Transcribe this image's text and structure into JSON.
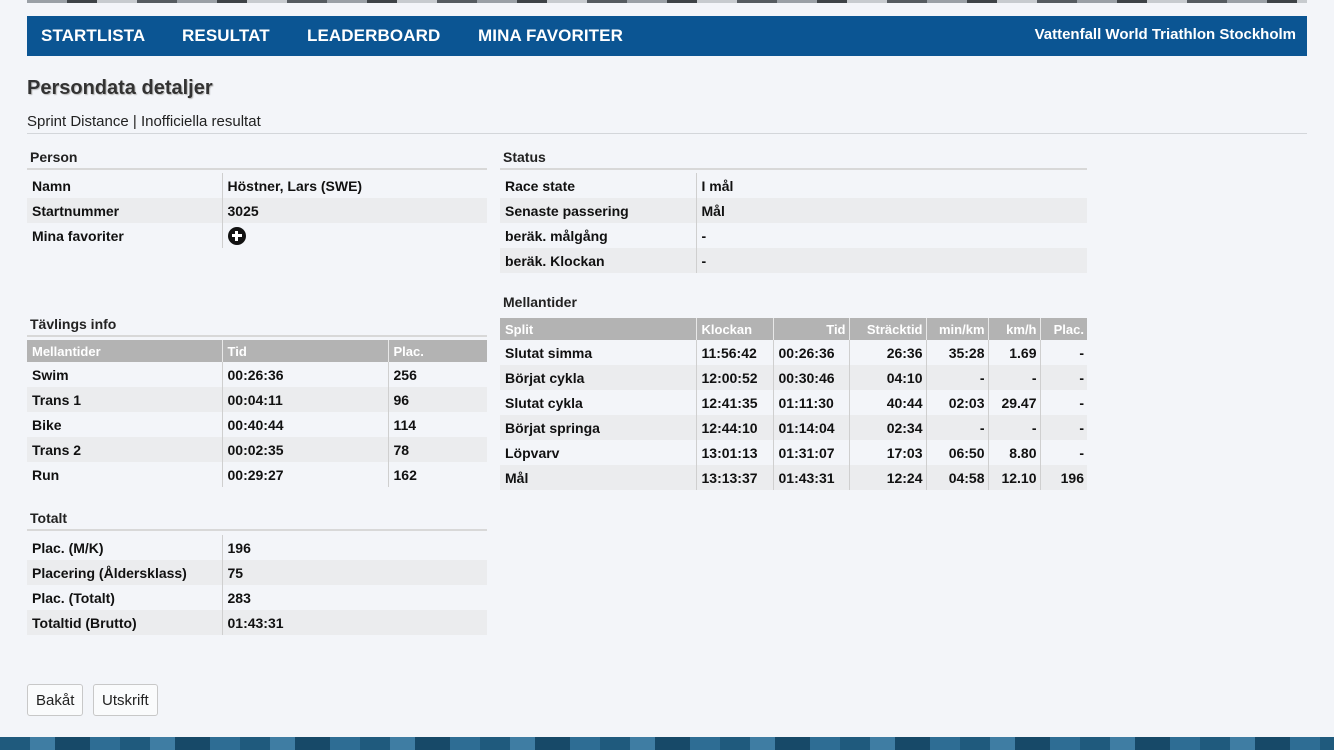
{
  "nav": {
    "items": [
      "STARTLISTA",
      "RESULTAT",
      "LEADERBOARD",
      "MINA FAVORITER"
    ],
    "site_title": "Vattenfall World Triathlon Stockholm",
    "color": "#0b5593"
  },
  "page": {
    "title": "Persondata detaljer",
    "subtitle": "Sprint Distance | Inofficiella resultat"
  },
  "person": {
    "heading": "Person",
    "rows": [
      {
        "label": "Namn",
        "value": "Höstner, Lars (SWE)"
      },
      {
        "label": "Startnummer",
        "value": "3025"
      },
      {
        "label": "Mina favoriter",
        "icon": "plus-circle-icon"
      }
    ]
  },
  "status": {
    "heading": "Status",
    "rows": [
      {
        "label": "Race state",
        "value": "I mål"
      },
      {
        "label": "Senaste passering",
        "value": "Mål"
      },
      {
        "label": "beräk. målgång",
        "value": "-"
      },
      {
        "label": "beräk. Klockan",
        "value": "-"
      }
    ]
  },
  "competition_info": {
    "heading": "Tävlings info",
    "columns": [
      "Mellantider",
      "Tid",
      "Plac."
    ],
    "rows": [
      [
        "Swim",
        "00:26:36",
        "256"
      ],
      [
        "Trans 1",
        "00:04:11",
        "96"
      ],
      [
        "Bike",
        "00:40:44",
        "114"
      ],
      [
        "Trans 2",
        "00:02:35",
        "78"
      ],
      [
        "Run",
        "00:29:27",
        "162"
      ]
    ]
  },
  "totals": {
    "heading": "Totalt",
    "rows": [
      {
        "label": "Plac. (M/K)",
        "value": "196"
      },
      {
        "label": "Placering (Åldersklass)",
        "value": "75"
      },
      {
        "label": "Plac. (Totalt)",
        "value": "283"
      },
      {
        "label": "Totaltid (Brutto)",
        "value": "01:43:31"
      }
    ]
  },
  "splits": {
    "heading": "Mellantider",
    "columns": [
      "Split",
      "Klockan",
      "Tid",
      "Sträcktid",
      "min/km",
      "km/h",
      "Plac."
    ],
    "rows": [
      [
        "Slutat simma",
        "11:56:42",
        "00:26:36",
        "26:36",
        "35:28",
        "1.69",
        "-"
      ],
      [
        "Börjat cykla",
        "12:00:52",
        "00:30:46",
        "04:10",
        "-",
        "-",
        "-"
      ],
      [
        "Slutat cykla",
        "12:41:35",
        "01:11:30",
        "40:44",
        "02:03",
        "29.47",
        "-"
      ],
      [
        "Börjat springa",
        "12:44:10",
        "01:14:04",
        "02:34",
        "-",
        "-",
        "-"
      ],
      [
        "Löpvarv",
        "13:01:13",
        "01:31:07",
        "17:03",
        "06:50",
        "8.80",
        "-"
      ],
      [
        "Mål",
        "13:13:37",
        "01:43:31",
        "12:24",
        "04:58",
        "12.10",
        "196"
      ]
    ]
  },
  "buttons": {
    "back": "Bakåt",
    "print": "Utskrift"
  }
}
